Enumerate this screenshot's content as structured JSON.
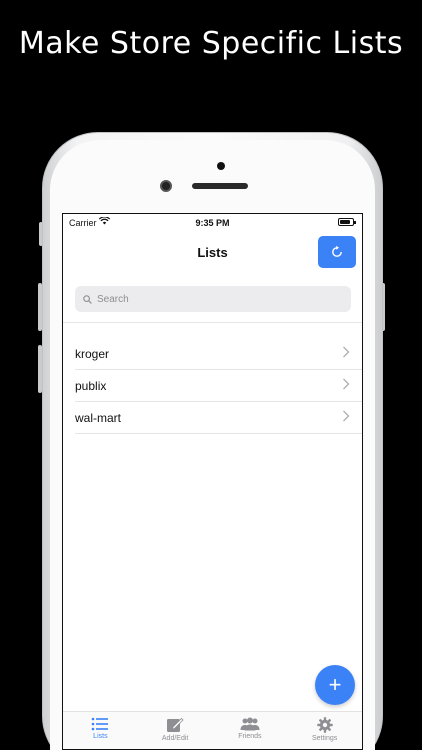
{
  "headline": "Make Store Specific Lists",
  "status_bar": {
    "carrier": "Carrier",
    "time": "9:35 PM"
  },
  "nav": {
    "title": "Lists",
    "refresh_icon": "refresh-icon"
  },
  "search": {
    "placeholder": "Search"
  },
  "lists": [
    {
      "label": "kroger"
    },
    {
      "label": "publix"
    },
    {
      "label": "wal-mart"
    }
  ],
  "fab": {
    "label": "+"
  },
  "tabs": [
    {
      "label": "Lists",
      "icon": "list-icon",
      "active": true
    },
    {
      "label": "Add/Edit",
      "icon": "edit-icon",
      "active": false
    },
    {
      "label": "Friends",
      "icon": "friends-icon",
      "active": false
    },
    {
      "label": "Settings",
      "icon": "gear-icon",
      "active": false
    }
  ],
  "colors": {
    "accent": "#3b82f6",
    "tab_inactive": "#8e8e93"
  }
}
